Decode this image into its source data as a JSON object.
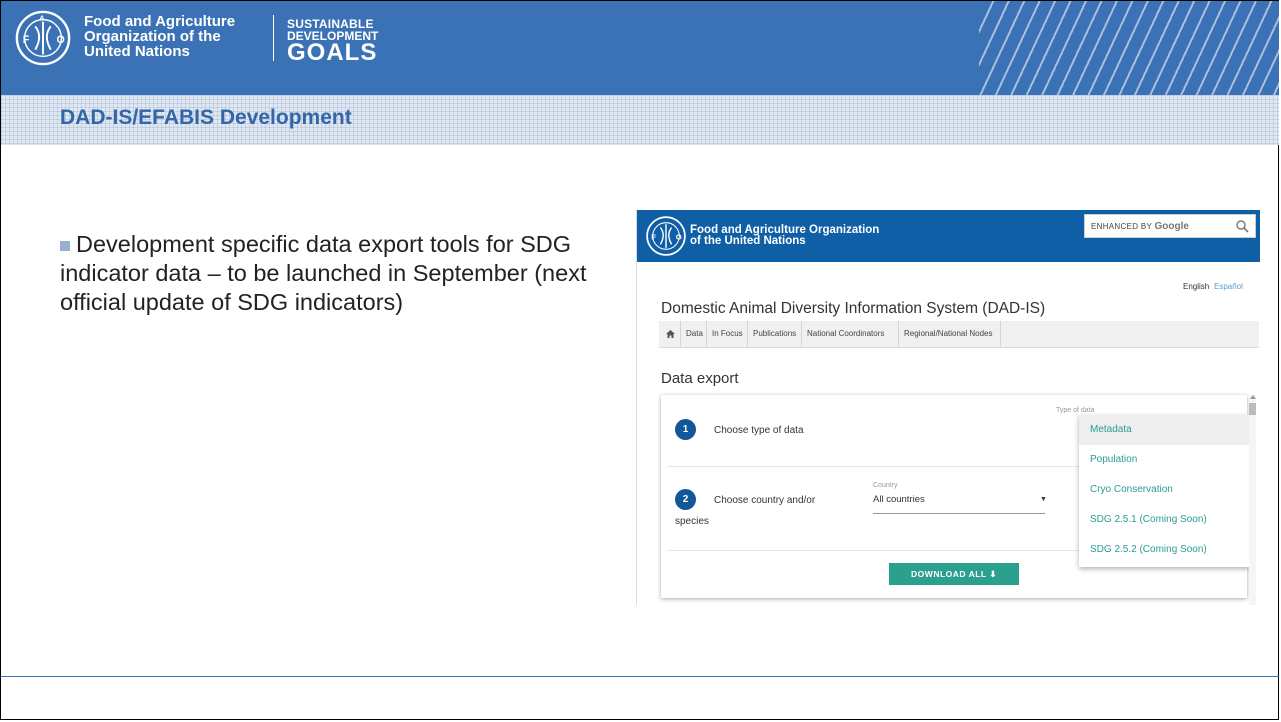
{
  "slide": {
    "org_name_lines": [
      "Food and Agriculture",
      "Organization of the",
      "United Nations"
    ],
    "sdg_lines": [
      "SUSTAINABLE",
      "DEVELOPMENT",
      "GOALS"
    ],
    "title": "DAD-IS/EFABIS Development",
    "bullet": "Development specific data export tools for SDG indicator data – to be launched in September (next official update of SDG indicators)"
  },
  "screenshot": {
    "org_name_lines": [
      "Food and Agriculture Organization",
      "of the United Nations"
    ],
    "search": {
      "prefix": "ENHANCED BY",
      "brand": "Google"
    },
    "languages": {
      "english": "English",
      "spanish": "Español"
    },
    "site_title": "Domestic Animal Diversity Information System (DAD-IS)",
    "nav": [
      "Data",
      "In Focus",
      "Publications",
      "National Coordinators",
      "Regional/National Nodes"
    ],
    "section_title": "Data export",
    "steps": [
      {
        "number": "1",
        "label": "Choose type of data"
      },
      {
        "number": "2",
        "label_line1": "Choose country and/or",
        "label_line2": "species"
      }
    ],
    "type_of_data_label": "Type of data",
    "country_label": "Country",
    "country_value": "All countries",
    "dropdown_arrow": "▼",
    "type_options": [
      "Metadata",
      "Population",
      "Cryo Conservation",
      "SDG 2.5.1 (Coming Soon)",
      "SDG 2.5.2 (Coming Soon)"
    ],
    "download_label": "DOWNLOAD ALL  ⬇"
  },
  "colors": {
    "header_blue": "#3a72b5",
    "title_blue": "#3366a6",
    "site_blue": "#0f5fa7",
    "teal": "#2ba08e"
  }
}
